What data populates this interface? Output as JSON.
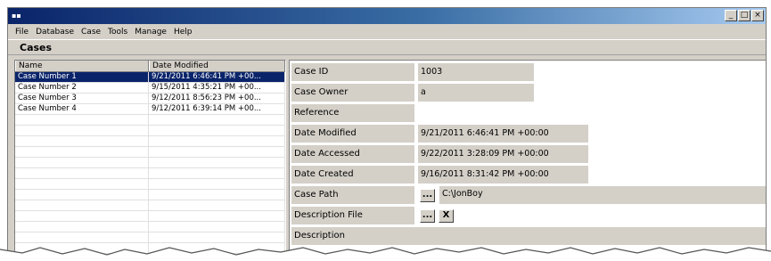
{
  "window": {
    "icon": "app-icon",
    "buttons": [
      "_",
      "□",
      "×"
    ]
  },
  "menu": [
    "File",
    "Database",
    "Case",
    "Tools",
    "Manage",
    "Help"
  ],
  "panel_title": "Cases",
  "list": {
    "headers": [
      "Name",
      "Date Modified"
    ],
    "rows": [
      {
        "name": "Case Number 1",
        "date": "9/21/2011 6:46:41 PM +00...",
        "selected": true
      },
      {
        "name": "Case Number 2",
        "date": "9/15/2011 4:35:21 PM +00...",
        "selected": false
      },
      {
        "name": "Case Number 3",
        "date": "9/12/2011 8:56:23 PM +00...",
        "selected": false
      },
      {
        "name": "Case Number 4",
        "date": "9/12/2011 6:39:14 PM +00...",
        "selected": false
      }
    ]
  },
  "props": {
    "case_id": {
      "label": "Case ID",
      "value": "1003"
    },
    "case_owner": {
      "label": "Case Owner",
      "value": "a"
    },
    "reference": {
      "label": "Reference",
      "value": ""
    },
    "date_modified": {
      "label": "Date Modified",
      "value": "9/21/2011 6:46:41 PM +00:00"
    },
    "date_accessed": {
      "label": "Date Accessed",
      "value": "9/22/2011 3:28:09 PM +00:00"
    },
    "date_created": {
      "label": "Date Created",
      "value": "9/16/2011 8:31:42 PM +00:00"
    },
    "case_path": {
      "label": "Case Path",
      "button": "...",
      "value": "C:\\JonBoy"
    },
    "description_file": {
      "label": "Description File",
      "browse_button": "...",
      "clear_button": "X"
    },
    "description": {
      "label": "Description"
    }
  }
}
